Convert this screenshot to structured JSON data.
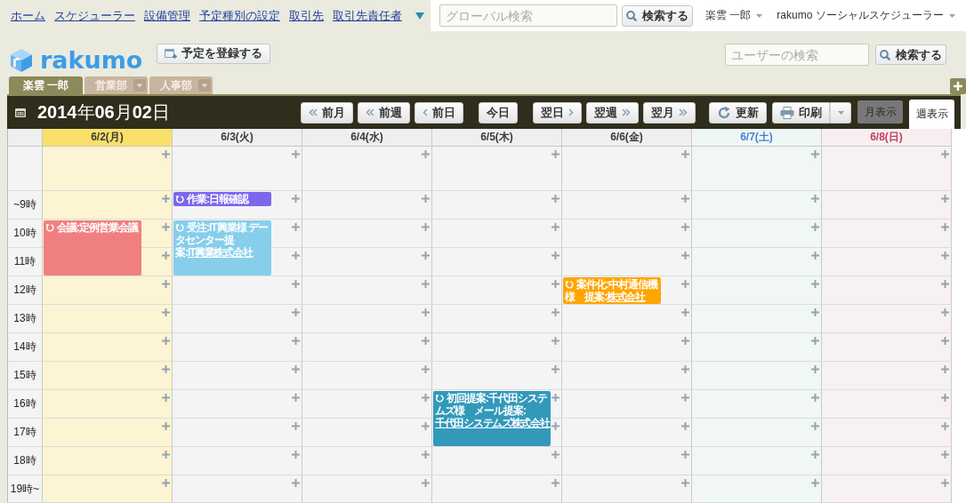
{
  "top_nav": {
    "links": [
      "ホーム",
      "スケジューラー",
      "設備管理",
      "予定種別の設定",
      "取引先",
      "取引先責任者"
    ]
  },
  "global_search": {
    "placeholder": "グローバル検索",
    "button": "検索する"
  },
  "user_menu": {
    "label": "楽雲 一郎"
  },
  "app_menu": {
    "label": "rakumo ソーシャルスケジューラー"
  },
  "logo": {
    "text": "rakumo"
  },
  "new_event_button": {
    "label": "予定を登録する"
  },
  "user_search": {
    "placeholder": "ユーザーの検索",
    "button": "検索する"
  },
  "tabs": [
    {
      "label": "楽雲 一郎",
      "selected": true,
      "dropdown": false
    },
    {
      "label": "営業部",
      "selected": false,
      "dropdown": true
    },
    {
      "label": "人事部",
      "selected": false,
      "dropdown": true
    }
  ],
  "toolbar": {
    "title": "**2014**年**06**月**02**日",
    "nav_buttons": [
      {
        "label": "前月",
        "kind": "rewind"
      },
      {
        "label": "前週",
        "kind": "rewind"
      },
      {
        "label": "前日",
        "kind": "back"
      },
      {
        "label": "今日",
        "kind": "plain"
      },
      {
        "label": "翌日",
        "kind": "forward"
      },
      {
        "label": "翌週",
        "kind": "fastforward"
      },
      {
        "label": "翌月",
        "kind": "fastforward"
      }
    ],
    "refresh_button": "更新",
    "print_button": "印刷",
    "views": [
      {
        "label": "月表示",
        "selected": false
      },
      {
        "label": "週表示",
        "selected": true
      }
    ]
  },
  "calendar": {
    "days": [
      {
        "label": "6/2(月)",
        "kind": "today"
      },
      {
        "label": "6/3(火)",
        "kind": "weekday"
      },
      {
        "label": "6/4(水)",
        "kind": "weekday"
      },
      {
        "label": "6/5(木)",
        "kind": "weekday"
      },
      {
        "label": "6/6(金)",
        "kind": "weekday"
      },
      {
        "label": "6/7(土)",
        "kind": "saturday"
      },
      {
        "label": "6/8(日)",
        "kind": "sunday"
      }
    ],
    "rows": [
      {
        "kind": "all-day",
        "cells": [
          {},
          {},
          {},
          {},
          {},
          {},
          {}
        ]
      },
      {
        "kind": "hour",
        "label": "~9時",
        "cells": [
          {},
          {
            "events": [
              {
                "title": "作業:日報確認",
                "recurring": true,
                "color": "#7b68ee",
                "kind": "short"
              }
            ]
          },
          {},
          {},
          {},
          {},
          {}
        ]
      },
      {
        "kind": "hour",
        "label": "10時",
        "cells": [
          {
            "events": [
              {
                "title": "会議:定例営業会議",
                "recurring": true,
                "color": "#f08080",
                "kind": "double"
              }
            ]
          },
          {
            "events": [
              {
                "title": "受注:IT興業様 データセンター提案:",
                "link": "IT興業株式会社",
                "recurring": true,
                "color": "#87ceeb",
                "kind": "double"
              }
            ]
          },
          {},
          {},
          {},
          {},
          {}
        ]
      },
      {
        "kind": "hour",
        "label": "11時",
        "cells": [
          {},
          {},
          {},
          {},
          {},
          {},
          {}
        ]
      },
      {
        "kind": "hour",
        "label": "12時",
        "cells": [
          {},
          {},
          {},
          {},
          {
            "events": [
              {
                "title": "案件化:中村通信機様　提案:",
                "link": "株式会社",
                "recurring": true,
                "color": "#ffa500",
                "kind": "single"
              }
            ]
          },
          {},
          {}
        ]
      },
      {
        "kind": "hour",
        "label": "13時",
        "cells": [
          {},
          {},
          {},
          {},
          {},
          {},
          {}
        ]
      },
      {
        "kind": "hour",
        "label": "14時",
        "cells": [
          {},
          {},
          {},
          {},
          {},
          {},
          {}
        ]
      },
      {
        "kind": "hour",
        "label": "15時",
        "cells": [
          {},
          {},
          {},
          {},
          {},
          {},
          {}
        ]
      },
      {
        "kind": "hour",
        "label": "16時",
        "cells": [
          {},
          {},
          {},
          {
            "events": [
              {
                "title": "初回提案:千代田システムズ様　メール提案:",
                "link": "千代田システムズ株式会社",
                "recurring": true,
                "color": "#3399bb",
                "kind": "double"
              }
            ]
          },
          {},
          {},
          {}
        ]
      },
      {
        "kind": "hour",
        "label": "17時",
        "cells": [
          {},
          {},
          {},
          {},
          {},
          {},
          {}
        ]
      },
      {
        "kind": "hour",
        "label": "18時",
        "cells": [
          {},
          {},
          {},
          {},
          {},
          {},
          {}
        ]
      },
      {
        "kind": "hour",
        "label": "19時~",
        "cells": [
          {},
          {},
          {},
          {},
          {},
          {},
          {}
        ]
      }
    ]
  }
}
